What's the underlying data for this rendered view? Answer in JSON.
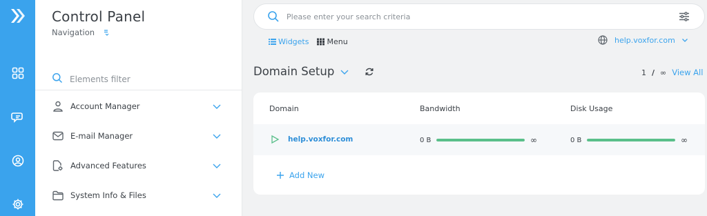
{
  "colors": {
    "accent": "#3aa3ed",
    "rail": "#3aa3ed",
    "success": "#5abf8a",
    "text": "#3b4046"
  },
  "rail": {
    "items": [
      "logo-icon",
      "widgets-grid-icon",
      "chat-icon",
      "user-circle-icon",
      "settings-gear-icon"
    ]
  },
  "nav": {
    "title": "Control Panel",
    "subtitle": "Navigation",
    "filter_placeholder": "Elements filter",
    "items": [
      {
        "label": "Account Manager",
        "icon": "user-icon"
      },
      {
        "label": "E-mail Manager",
        "icon": "envelope-icon"
      },
      {
        "label": "Advanced Features",
        "icon": "document-gear-icon"
      },
      {
        "label": "System Info & Files",
        "icon": "folder-icon"
      }
    ]
  },
  "search": {
    "placeholder": "Please enter your search criteria",
    "value": ""
  },
  "view_tabs": [
    {
      "label": "Widgets",
      "active": true,
      "icon": "list-icon"
    },
    {
      "label": "Menu",
      "active": false,
      "icon": "grid-icon"
    }
  ],
  "site": {
    "current": "help.voxfor.com"
  },
  "section": {
    "title": "Domain Setup",
    "pager": {
      "current": "1",
      "separator": "/",
      "total": "∞",
      "view_all": "View All"
    }
  },
  "table": {
    "headers": [
      "Domain",
      "Bandwidth",
      "Disk Usage"
    ],
    "rows": [
      {
        "domain": "help.voxfor.com",
        "bandwidth": {
          "used": "0 B",
          "max": "∞",
          "fill_fraction": 1.0
        },
        "disk": {
          "used": "0 B",
          "max": "∞",
          "fill_fraction": 1.0
        }
      }
    ],
    "add_new_label": "Add New"
  }
}
